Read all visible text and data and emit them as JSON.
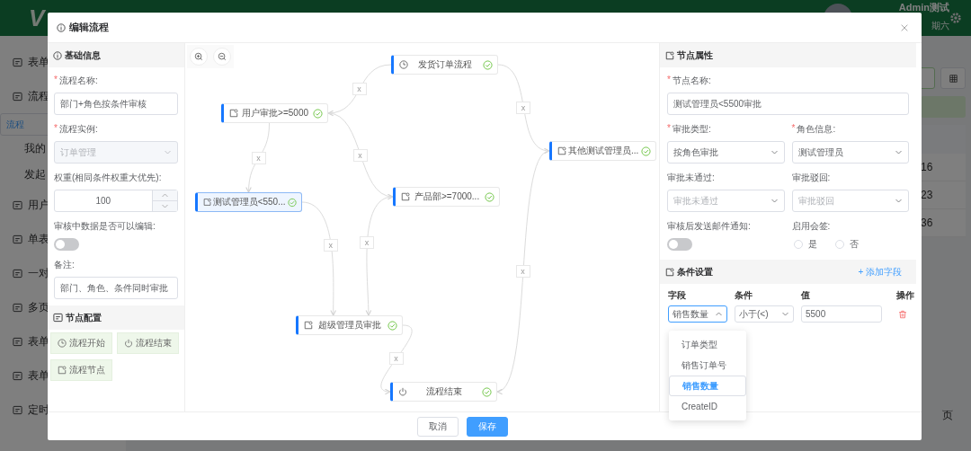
{
  "app": {
    "logo": "V",
    "user": "Admin测试",
    "date": "期六",
    "sidebar": [
      {
        "label": "表单",
        "selected": false
      },
      {
        "label": "流程",
        "selected": false,
        "children": [
          {
            "label": "流程",
            "selected": true
          },
          {
            "label": "我的",
            "selected": false
          },
          {
            "label": "发起",
            "selected": false
          }
        ]
      },
      {
        "label": "用户",
        "selected": false
      },
      {
        "label": "单表",
        "selected": false
      },
      {
        "label": "一对",
        "selected": false
      },
      {
        "label": "多页",
        "selected": false
      },
      {
        "label": "表单",
        "selected": false
      },
      {
        "label": "表单",
        "selected": false
      },
      {
        "label": "定时",
        "selected": false
      }
    ],
    "cells": [
      "16",
      "23",
      "36"
    ],
    "pager": "页"
  },
  "dialog": {
    "title": "编辑流程",
    "basic": {
      "title": "基础信息",
      "fields": [
        {
          "kind": "text",
          "mark": "*",
          "label": "流程名称:",
          "value": "部门+角色按条件审核"
        },
        {
          "kind": "select",
          "mark": "*",
          "label": "流程实例:",
          "value": "订单管理",
          "disabled": true
        },
        {
          "kind": "number",
          "label": "权重(相同条件权重大优先):",
          "value": "100"
        },
        {
          "kind": "switch",
          "label": "审核中数据是否可以编辑:",
          "on": false
        },
        {
          "kind": "text",
          "label": "备注:",
          "value": "部门、角色、条件同时审批"
        }
      ]
    },
    "palette": {
      "title": "节点配置",
      "items": [
        {
          "kind": "start",
          "label": "流程开始"
        },
        {
          "kind": "end",
          "label": "流程结束"
        },
        {
          "kind": "task",
          "label": "流程节点"
        }
      ]
    },
    "canvas": {
      "nodes": [
        {
          "kind": "start",
          "label": "发货订单流程",
          "selected": false
        },
        {
          "kind": "task",
          "label": "用户审批>=5000",
          "selected": false
        },
        {
          "kind": "task",
          "label": "其他测试管理员...",
          "selected": false
        },
        {
          "kind": "task",
          "label": "测试管理员<550...",
          "selected": true
        },
        {
          "kind": "task",
          "label": "产品部>=7000...",
          "selected": false
        },
        {
          "kind": "task",
          "label": "超级管理员审批",
          "selected": false
        },
        {
          "kind": "end",
          "label": "流程结束",
          "selected": false
        }
      ],
      "edges": [
        {
          "label": "x"
        },
        {
          "label": "x"
        },
        {
          "label": "x"
        },
        {
          "label": "x"
        },
        {
          "label": "x"
        },
        {
          "label": "x"
        },
        {
          "label": "x"
        },
        {
          "label": "x"
        }
      ]
    },
    "props": {
      "title": "节点属性",
      "fields": [
        {
          "kind": "text",
          "mark": "*",
          "label": "节点名称:",
          "value": "测试管理员<5500审批"
        },
        {
          "kind": "select",
          "mark": "*",
          "label": "审批类型:",
          "value": "按角色审批"
        },
        {
          "kind": "select",
          "mark": "*",
          "label": "角色信息:",
          "value": "测试管理员"
        },
        {
          "kind": "select",
          "label": "审批未通过:",
          "placeholder": "审批未通过"
        },
        {
          "kind": "select",
          "label": "审批驳回:",
          "placeholder": "审批驳回"
        },
        {
          "kind": "switch",
          "label": "审核后发送邮件通知:",
          "on": false
        },
        {
          "kind": "radio",
          "label": "启用会签:",
          "options": [
            {
              "label": "是",
              "selected": false
            },
            {
              "label": "否",
              "selected": false
            }
          ]
        }
      ]
    },
    "conditions": {
      "title": "条件设置",
      "add": "+ 添加字段",
      "columns": [
        "字段",
        "条件",
        "值",
        "操作"
      ],
      "rows": [
        {
          "field": "销售数量",
          "open": true,
          "op": "小于(<)",
          "value": "5500"
        }
      ],
      "options": [
        {
          "label": "订单类型",
          "selected": false
        },
        {
          "label": "销售订单号",
          "selected": false
        },
        {
          "label": "销售数量",
          "selected": true
        },
        {
          "label": "CreateID",
          "selected": false
        }
      ]
    },
    "buttons": [
      {
        "kind": "default",
        "label": "取消"
      },
      {
        "kind": "primary",
        "label": "保存"
      }
    ]
  }
}
